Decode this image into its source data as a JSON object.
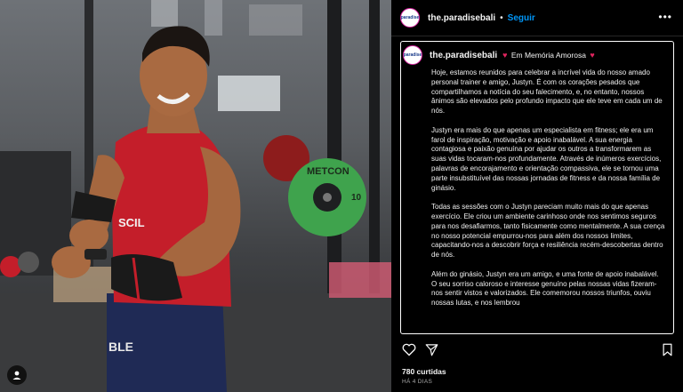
{
  "post": {
    "username": "the.paradisebali",
    "follow_label": "Seguir",
    "avatar_text": "paradise",
    "caption_title": "Em Memória Amorosa",
    "paragraphs": [
      "Hoje, estamos reunidos para celebrar a incrível vida do nosso amado personal trainer e amigo, Justyn. É com os corações pesados que compartilhamos a notícia do seu falecimento, e, no entanto, nossos ânimos são elevados pelo profundo impacto que ele teve em cada um de nós.",
      "Justyn era mais do que apenas um especialista em fitness; ele era um farol de inspiração, motivação e apoio inabalável. A sua energia contagiosa e paixão genuína por ajudar os outros a transformarem as suas vidas tocaram-nos profundamente. Através de inúmeros exercícios, palavras de encorajamento e orientação compassiva, ele se tornou uma parte insubstituível das nossas jornadas de fitness e da nossa família de ginásio.",
      "Todas as sessões com o Justyn pareciam muito mais do que apenas exercício. Ele criou um ambiente carinhoso onde nos sentimos seguros para nos desafiarmos, tanto fisicamente como mentalmente. A sua crença no nosso potencial empurrou-nos para além dos nossos limites, capacitando-nos a descobrir força e resiliência recém-descobertas dentro de nós.",
      "Além do ginásio, Justyn era um amigo, e uma fonte de apoio inabalável. O seu sorriso caloroso e interesse genuíno pelas nossas vidas fizeram-nos sentir vistos e valorizados. Ele comemorou nossos triunfos, ouviu nossas lutas, e nos lembrou"
    ],
    "likes": "780 curtidas",
    "date": "HÁ 4 DIAS"
  },
  "photo": {
    "plate_brand": "METCON",
    "plate_weight": "10",
    "shirt_text": "SCIL",
    "shorts_text": "BLE"
  },
  "icons": {
    "more": "more-options-icon",
    "heart": "heart-icon",
    "share": "share-icon",
    "save": "bookmark-icon",
    "tag": "user-tag-icon"
  },
  "colors": {
    "follow": "#0095f6",
    "heart_emoji": "#e0245e",
    "plate_green": "#3fa34d",
    "shirt_red": "#c41e2a"
  }
}
